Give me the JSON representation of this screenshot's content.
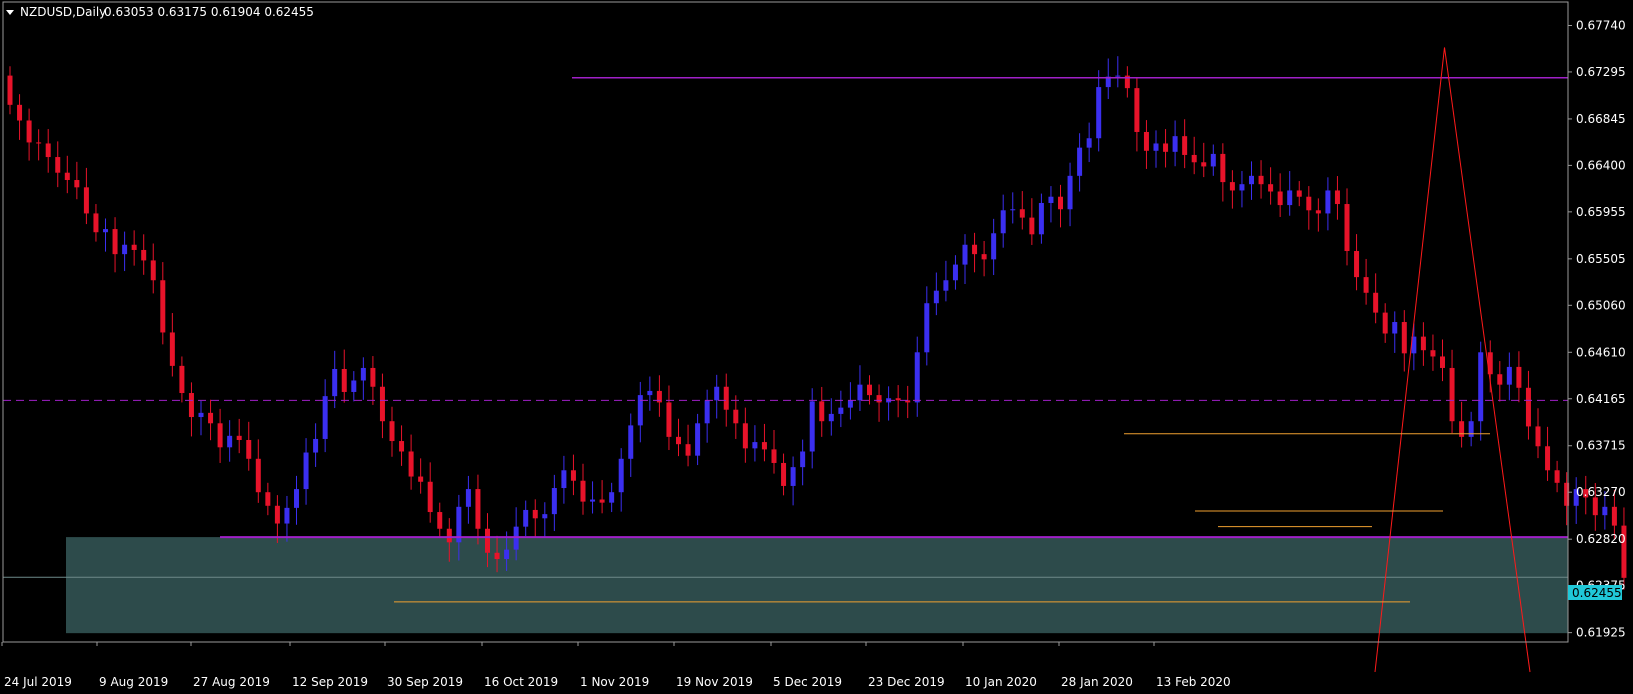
{
  "header": {
    "symbol": "NZDUSD,Daily",
    "ohlc": "0.63053 0.63175 0.61904 0.62455"
  },
  "price_tag": "0.62455",
  "colors": {
    "background": "#000000",
    "axis": "#9a9a9a",
    "bull_body": "#3b2ff0",
    "bear_body": "#e8132a",
    "resistance": "#a020c8",
    "support_zone": "#2f4f4f",
    "trendline": "#ff1a1a",
    "level_lines": "#f0a030",
    "price_tag_bg": "#20c8d8"
  },
  "chart_data": {
    "type": "candlestick",
    "title": "NZDUSD,Daily",
    "ylim": [
      0.6173,
      0.6785
    ],
    "y_ticks": [
      "0.67740",
      "0.67295",
      "0.66845",
      "0.66400",
      "0.65955",
      "0.65505",
      "0.65060",
      "0.64610",
      "0.64165",
      "0.63715",
      "0.63270",
      "0.62820",
      "0.62375",
      "0.61925"
    ],
    "x_ticks": [
      "24 Jul 2019",
      "9 Aug 2019",
      "27 Aug 2019",
      "12 Sep 2019",
      "30 Sep 2019",
      "16 Oct 2019",
      "1 Nov 2019",
      "19 Nov 2019",
      "5 Dec 2019",
      "23 Dec 2019",
      "10 Jan 2020",
      "28 Jan 2020",
      "13 Feb 2020"
    ],
    "closes": [
      0.6698,
      0.6683,
      0.6662,
      0.6661,
      0.6648,
      0.6633,
      0.6626,
      0.6619,
      0.6594,
      0.6576,
      0.6579,
      0.6555,
      0.6564,
      0.6559,
      0.6549,
      0.653,
      0.648,
      0.6448,
      0.6422,
      0.6399,
      0.6403,
      0.6393,
      0.637,
      0.6381,
      0.6377,
      0.6359,
      0.6327,
      0.6314,
      0.6297,
      0.6312,
      0.633,
      0.6365,
      0.6378,
      0.6419,
      0.6445,
      0.6423,
      0.6434,
      0.6446,
      0.6428,
      0.6395,
      0.6376,
      0.6366,
      0.6342,
      0.6337,
      0.6308,
      0.6292,
      0.6279,
      0.6313,
      0.633,
      0.6292,
      0.6269,
      0.6263,
      0.6272,
      0.6294,
      0.631,
      0.6302,
      0.6306,
      0.6331,
      0.6348,
      0.6338,
      0.6318,
      0.632,
      0.6317,
      0.6327,
      0.6359,
      0.6391,
      0.642,
      0.6424,
      0.6413,
      0.638,
      0.6373,
      0.6362,
      0.6393,
      0.6415,
      0.6428,
      0.6406,
      0.6393,
      0.6369,
      0.6375,
      0.6368,
      0.6355,
      0.6333,
      0.6351,
      0.6366,
      0.6414,
      0.6395,
      0.6402,
      0.6408,
      0.6415,
      0.643,
      0.642,
      0.6413,
      0.6417,
      0.6415,
      0.6413,
      0.6461,
      0.6508,
      0.652,
      0.653,
      0.6545,
      0.6564,
      0.6555,
      0.655,
      0.6575,
      0.6597,
      0.6598,
      0.659,
      0.6574,
      0.6604,
      0.661,
      0.6598,
      0.663,
      0.6657,
      0.6666,
      0.6715,
      0.6725,
      0.6726,
      0.6714,
      0.6672,
      0.6654,
      0.6661,
      0.6653,
      0.6668,
      0.665,
      0.6643,
      0.6639,
      0.6651,
      0.6624,
      0.6616,
      0.6622,
      0.663,
      0.6622,
      0.6615,
      0.6602,
      0.6616,
      0.661,
      0.6597,
      0.6594,
      0.6616,
      0.6603,
      0.6558,
      0.6533,
      0.6518,
      0.6499,
      0.6479,
      0.649,
      0.646,
      0.6476,
      0.6463,
      0.6457,
      0.6446,
      0.6395,
      0.638,
      0.6395,
      0.6461,
      0.644,
      0.643,
      0.6447,
      0.6427,
      0.639,
      0.6371,
      0.6348,
      0.6336,
      0.6314,
      0.633,
      0.6322,
      0.6305,
      0.6313,
      0.6295,
      0.6245
    ],
    "bar_start": 0.6726,
    "bar_spacing": 6.06,
    "bar_count": 176,
    "resistance_level": 0.6724,
    "dashed_level": 0.6415,
    "support_zone": [
      0.6192,
      0.6284
    ],
    "trendline": [
      [
        150,
        0.6753
      ],
      [
        188,
        0.619
      ]
    ],
    "trendline_2": [
      [
        150,
        0.6753
      ],
      [
        176,
        0.6296
      ]
    ],
    "orange_levels": [
      0.6383,
      0.6309,
      0.6294,
      0.6222
    ]
  }
}
